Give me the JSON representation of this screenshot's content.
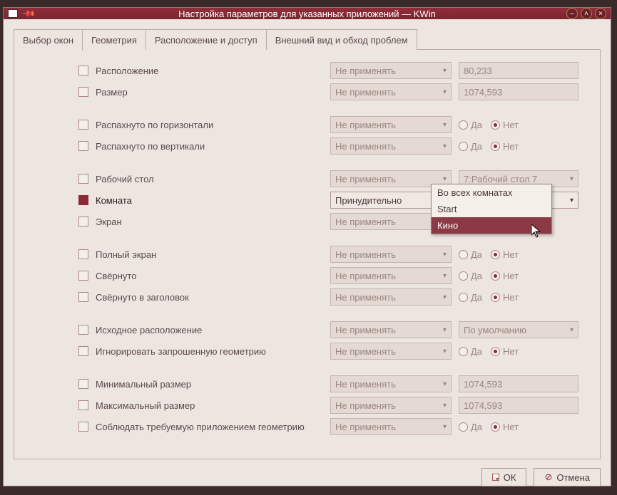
{
  "titlebar": {
    "title": "Настройка параметров для указанных приложений — KWin"
  },
  "tabs": {
    "t0": "Выбор окон",
    "t1": "Геометрия",
    "t2": "Расположение и доступ",
    "t3": "Внешний вид и обход проблем"
  },
  "combo": {
    "no_apply": "Не применять",
    "force": "Принудительно",
    "default": "По умолчанию",
    "desktop7": "7:Рабочий стол 7"
  },
  "rows": {
    "position": "Расположение",
    "size": "Размер",
    "max_h": "Распахнуто по горизонтали",
    "max_v": "Распахнуто по вертикали",
    "desktop": "Рабочий стол",
    "room": "Комната",
    "screen": "Экран",
    "fullscreen": "Полный экран",
    "minimized": "Свёрнуто",
    "shaded": "Свёрнуто в заголовок",
    "init_pos": "Исходное расположение",
    "ignore_geom": "Игнорировать запрошенную геометрию",
    "min_size": "Минимальный размер",
    "max_size": "Максимальный размер",
    "strict_geom": "Соблюдать требуемую приложением геометрию"
  },
  "values": {
    "pos": "80,233",
    "size": "1074,593",
    "minsize": "1074,593",
    "maxsize": "1074,593"
  },
  "radio": {
    "yes": "Да",
    "no": "Нет"
  },
  "dropdown": {
    "all": "Во всех комнатах",
    "start": "Start",
    "cinema": "Кино"
  },
  "buttons": {
    "ok": "ОК",
    "cancel": "Отмена"
  }
}
